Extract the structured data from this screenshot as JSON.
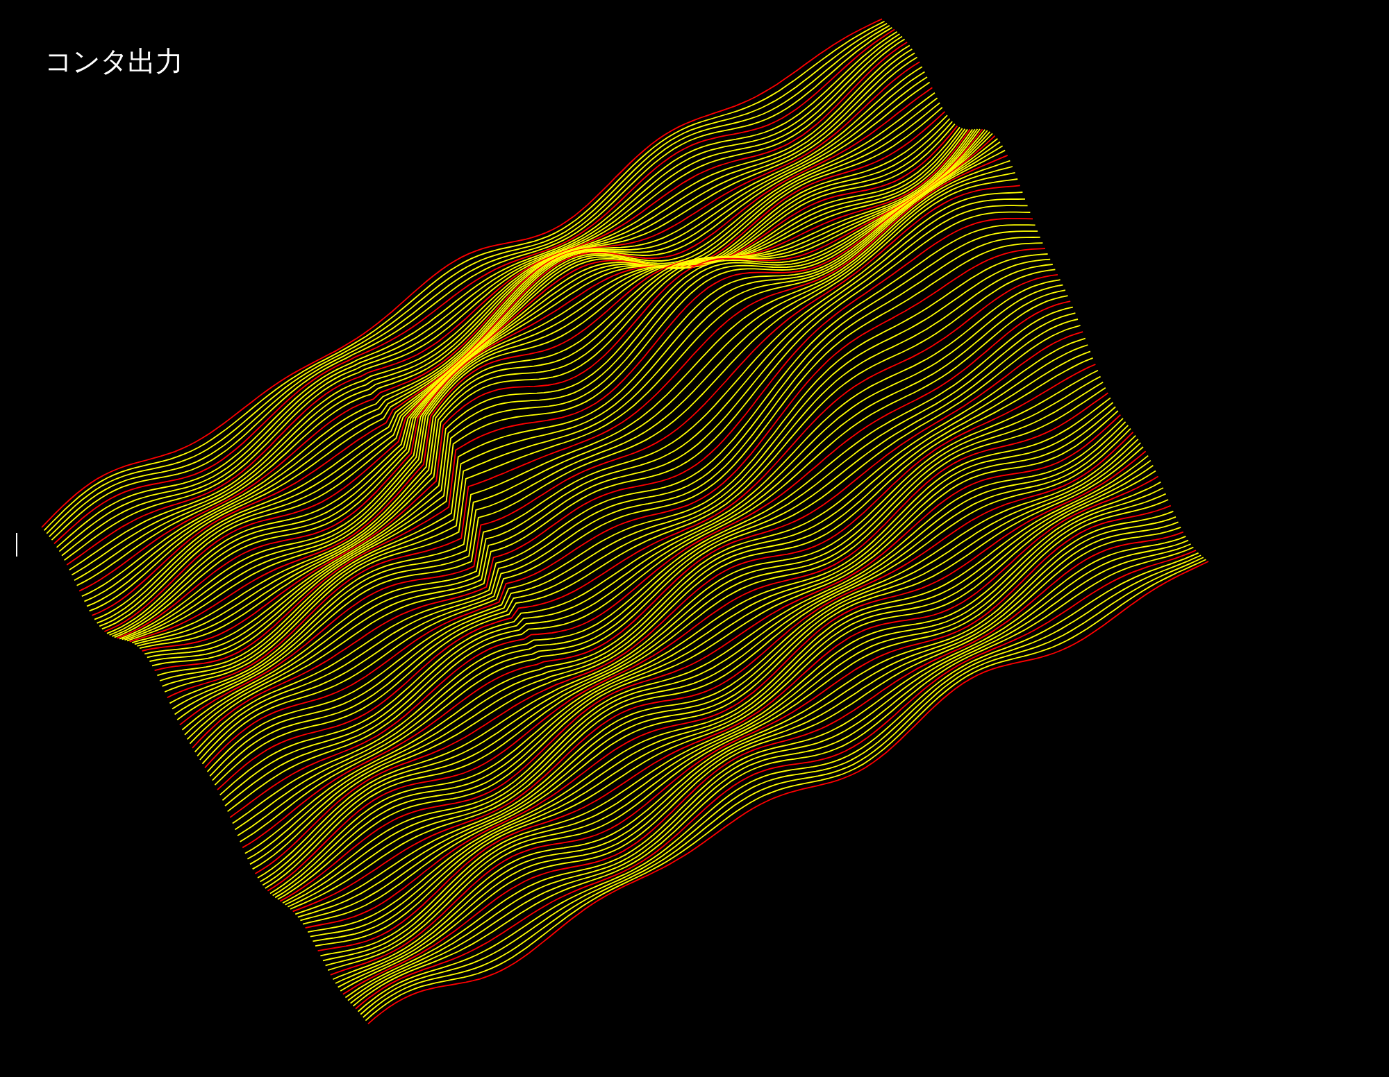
{
  "title": "コンタ出力"
}
